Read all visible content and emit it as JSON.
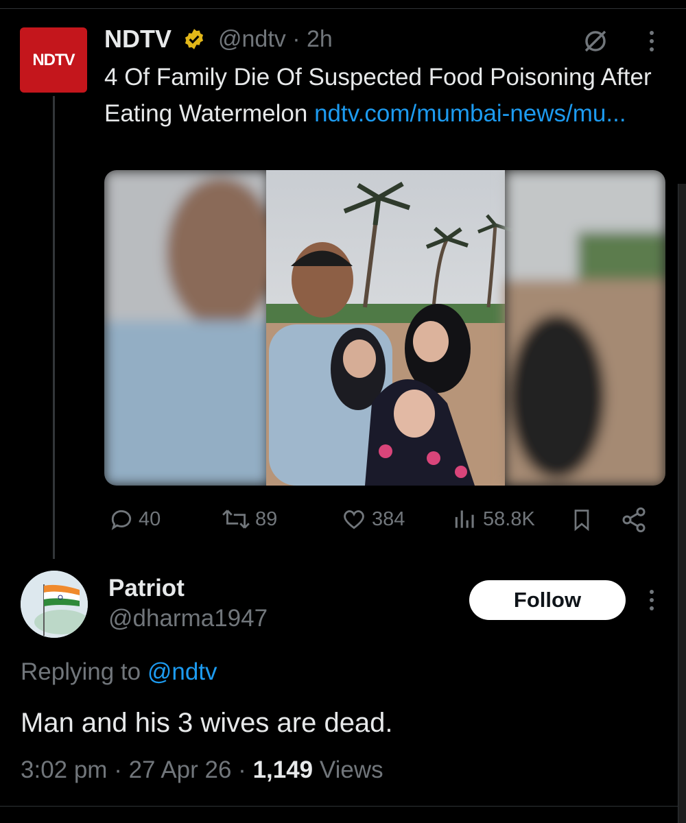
{
  "tweet": {
    "author_name": "NDTV",
    "author_logo_text": "NDTV",
    "handle": "@ndtv",
    "time": "2h",
    "separator": "·",
    "text": "4 Of Family Die Of Suspected Food Poisoning After Eating Watermelon",
    "link_text": "ndtv.com/mumbai-news/mu...",
    "stats": {
      "replies": "40",
      "retweets": "89",
      "likes": "384",
      "views": "58.8K"
    }
  },
  "reply": {
    "author_name": "Patriot",
    "handle": "@dharma1947",
    "follow_label": "Follow",
    "replying_prefix": "Replying to",
    "replying_to": "@ndtv",
    "text": "Man and his 3 wives are dead.",
    "time": "3:02 pm",
    "date": "27 Apr 26",
    "views_count": "1,149",
    "views_label": "Views"
  },
  "colors": {
    "background": "#000000",
    "link": "#1d9bf0",
    "muted": "#71767b",
    "ndtv_red": "#c4161c",
    "verified_gold": "#e2b719"
  },
  "icons": [
    "verified-badge-icon",
    "grok-icon",
    "more-icon",
    "reply-icon",
    "retweet-icon",
    "like-icon",
    "views-icon",
    "bookmark-icon",
    "share-icon",
    "flag-avatar"
  ]
}
